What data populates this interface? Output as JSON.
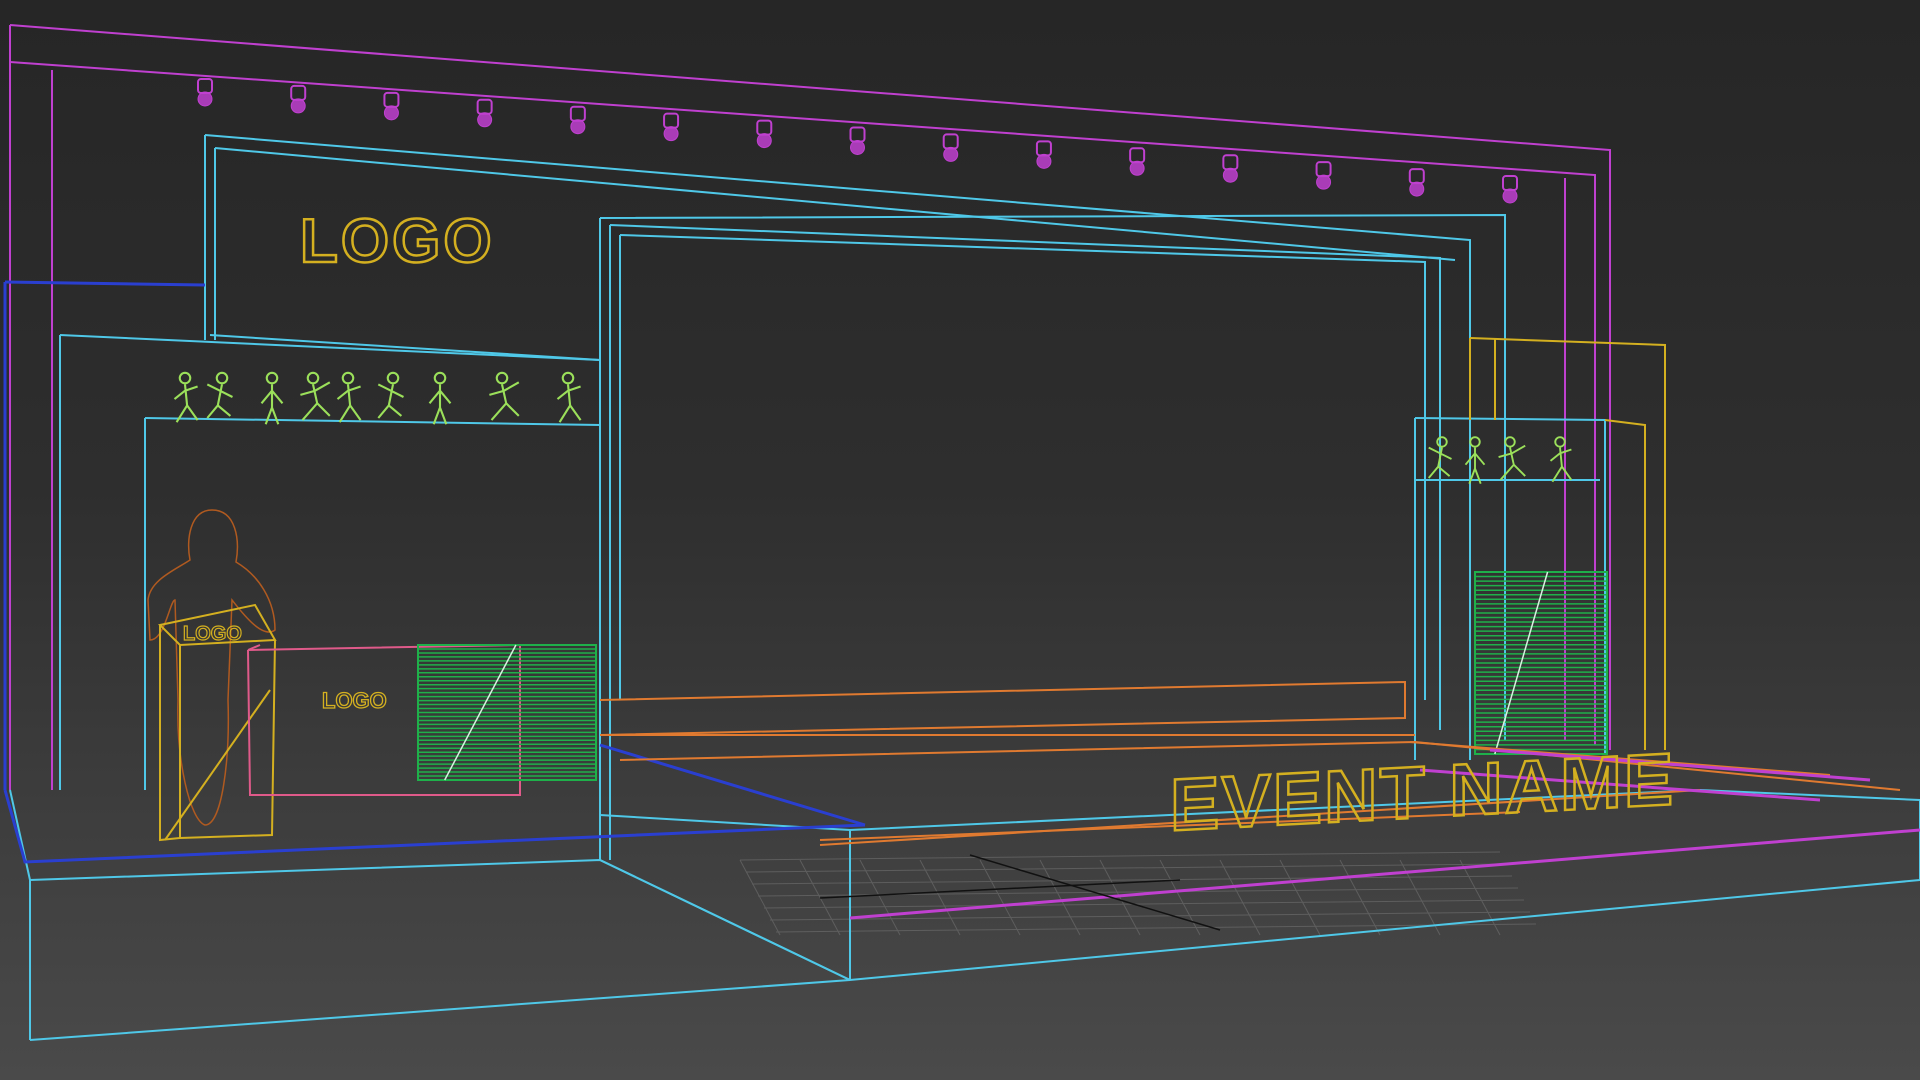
{
  "viewport": {
    "background_top": "#262626",
    "background_bottom": "#4a4a4a"
  },
  "scene": {
    "labels": {
      "main_logo": "LOGO",
      "podium_logo": "LOGO",
      "counter_logo": "LOGO",
      "event_name": "EVENT NAME"
    },
    "spotlight_count": 15,
    "colors": {
      "truss": "#c040d0",
      "frame": "#4fc8e8",
      "logo": "#d4b020",
      "figures": "#9be05a",
      "panel": "#1fb04a",
      "stair": "#e07a30",
      "platform_edge": "#2a3fd0",
      "person": "#b05a20",
      "grid": "#6a6a6a"
    }
  }
}
